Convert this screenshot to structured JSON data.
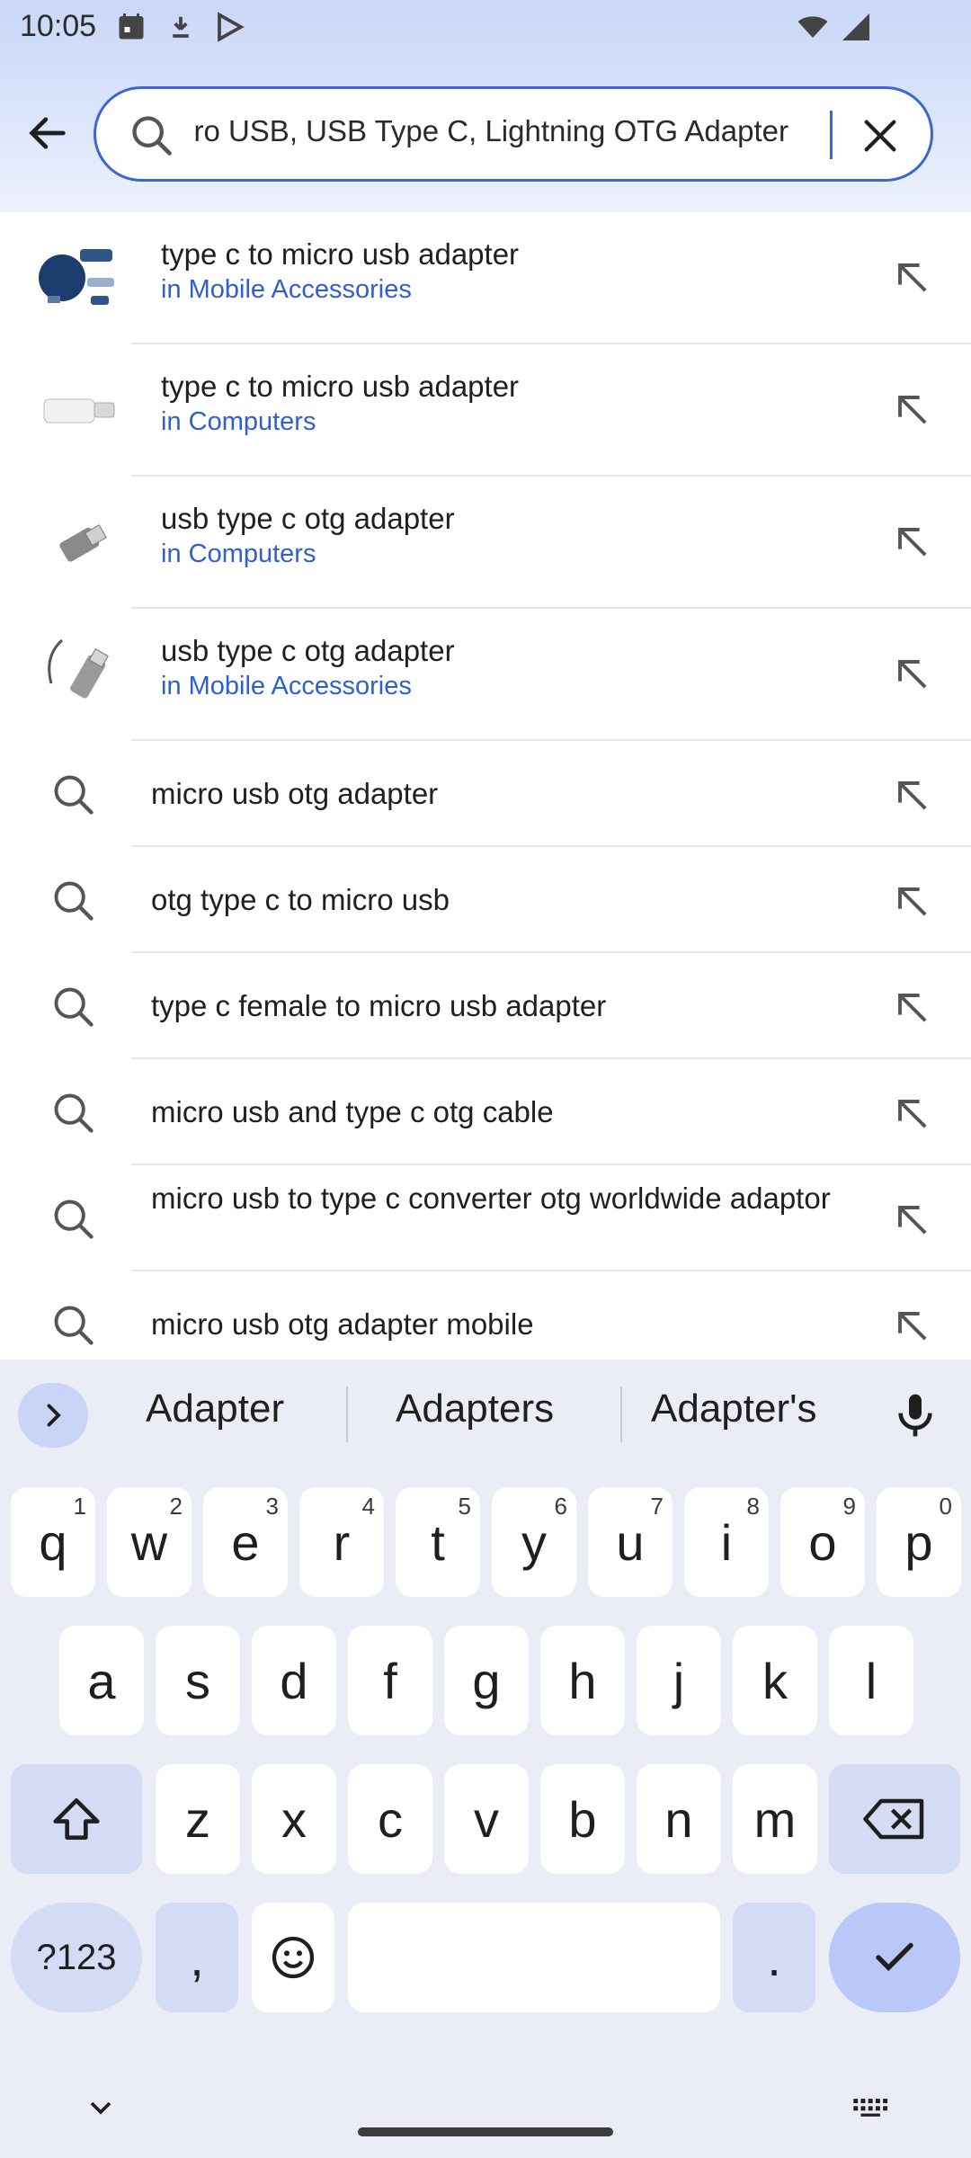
{
  "status_bar": {
    "time": "10:05"
  },
  "search": {
    "query": "ro USB, USB Type C, Lightning OTG Adapter"
  },
  "product_suggestions": [
    {
      "title": "type c to micro usb adapter",
      "category": "in Mobile Accessories"
    },
    {
      "title": "type c to micro usb adapter",
      "category": "in Computers"
    },
    {
      "title": "usb type c otg adapter",
      "category": "in Computers"
    },
    {
      "title": "usb type c otg adapter",
      "category": "in Mobile Accessories"
    }
  ],
  "query_suggestions": [
    "micro usb otg adapter",
    "otg type c to micro usb",
    "type c female to micro usb adapter",
    "micro usb and type c otg cable",
    "micro usb to type c converter otg worldwide adaptor",
    "micro usb otg adapter mobile"
  ],
  "keyboard": {
    "suggestions": [
      "Adapter",
      "Adapters",
      "Adapter's"
    ],
    "row1": [
      "q",
      "w",
      "e",
      "r",
      "t",
      "y",
      "u",
      "i",
      "o",
      "p"
    ],
    "row1_hints": [
      "1",
      "2",
      "3",
      "4",
      "5",
      "6",
      "7",
      "8",
      "9",
      "0"
    ],
    "row2": [
      "a",
      "s",
      "d",
      "f",
      "g",
      "h",
      "j",
      "k",
      "l"
    ],
    "row3": [
      "z",
      "x",
      "c",
      "v",
      "b",
      "n",
      "m"
    ],
    "symbols_label": "?123",
    "comma": ",",
    "period": "."
  },
  "colors": {
    "accent": "#3a66d6",
    "link": "#2f5fd3",
    "header_bg": "#c9d6f7",
    "keyboard_bg": "#eaedf5"
  }
}
